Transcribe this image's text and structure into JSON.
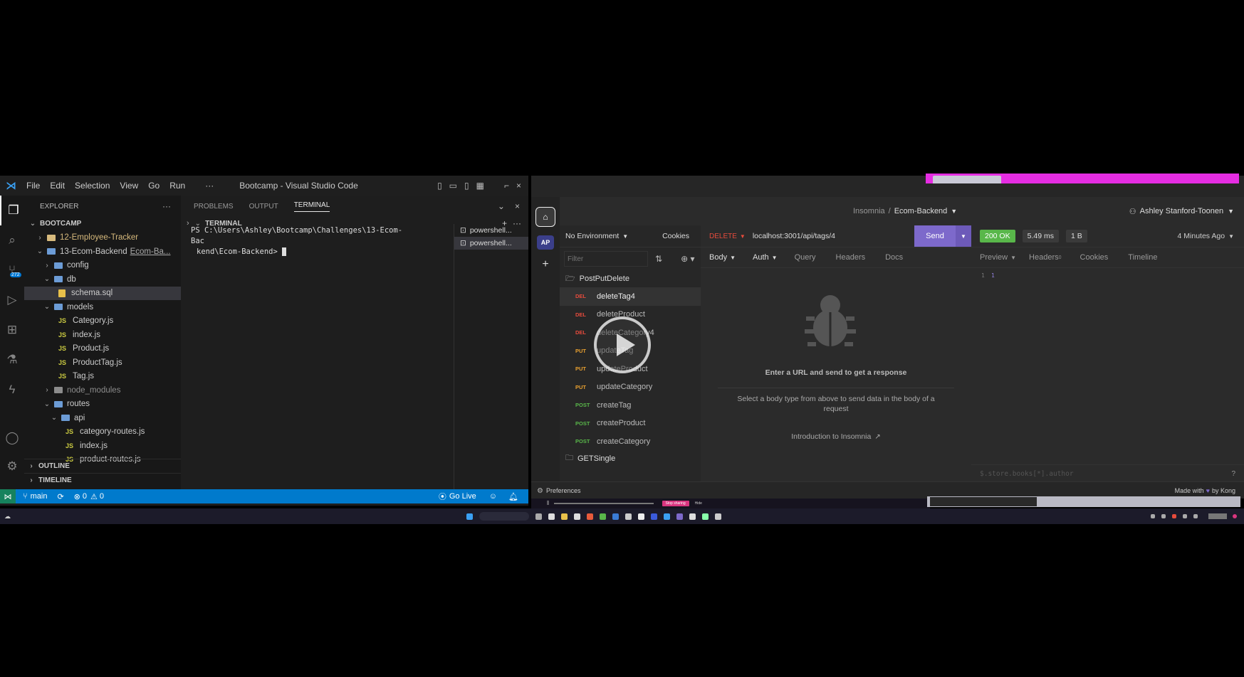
{
  "vscode": {
    "menu": [
      "File",
      "Edit",
      "Selection",
      "View",
      "Go",
      "Run"
    ],
    "menu_more": "···",
    "window_title": "Bootcamp - Visual Studio Code",
    "explorer_label": "EXPLORER",
    "explorer_more": "···",
    "workspace": "BOOTCAMP",
    "scm_badge": "272",
    "tree": [
      {
        "label": "12-Employee-Tracker",
        "depth": 1,
        "kind": "folder",
        "collapsed": true,
        "color": "#d7ba7d"
      },
      {
        "label": "13-Ecom-Backend",
        "path": "Ecom-Ba...",
        "depth": 1,
        "kind": "folder",
        "collapsed": false
      },
      {
        "label": "config",
        "depth": 2,
        "kind": "folder",
        "collapsed": true
      },
      {
        "label": "db",
        "depth": 2,
        "kind": "folder",
        "collapsed": false
      },
      {
        "label": "schema.sql",
        "depth": 3,
        "kind": "sql",
        "selected": true
      },
      {
        "label": "models",
        "depth": 2,
        "kind": "folder",
        "collapsed": false
      },
      {
        "label": "Category.js",
        "depth": 3,
        "kind": "js"
      },
      {
        "label": "index.js",
        "depth": 3,
        "kind": "js"
      },
      {
        "label": "Product.js",
        "depth": 3,
        "kind": "js"
      },
      {
        "label": "ProductTag.js",
        "depth": 3,
        "kind": "js"
      },
      {
        "label": "Tag.js",
        "depth": 3,
        "kind": "js"
      },
      {
        "label": "node_modules",
        "depth": 2,
        "kind": "folder",
        "collapsed": true,
        "color": "#8c8c8c"
      },
      {
        "label": "routes",
        "depth": 2,
        "kind": "folder",
        "collapsed": false
      },
      {
        "label": "api",
        "depth": 3,
        "kind": "folder",
        "collapsed": false
      },
      {
        "label": "category-routes.js",
        "depth": 4,
        "kind": "js"
      },
      {
        "label": "index.js",
        "depth": 4,
        "kind": "js"
      },
      {
        "label": "product-routes.js",
        "depth": 4,
        "kind": "js"
      }
    ],
    "outline_label": "OUTLINE",
    "timeline_label": "TIMELINE",
    "panel_tabs": [
      "PROBLEMS",
      "OUTPUT",
      "TERMINAL"
    ],
    "terminal_header": "TERMINAL",
    "terminal_line1": "PS C:\\Users\\Ashley\\Bootcamp\\Challenges\\13-Ecom-Bac",
    "terminal_line2": "kend\\Ecom-Backend> ",
    "terminal_sessions": [
      "powershell...",
      "powershell..."
    ],
    "status": {
      "branch": "main",
      "errors": "0",
      "warnings": "0",
      "golive": "Go Live"
    }
  },
  "insomnia": {
    "breadcrumb_root": "Insomnia",
    "breadcrumb_sep": "/",
    "project": "Ecom-Backend",
    "user": "Ashley Stanford-Toonen",
    "avatar_initials": "AP",
    "environment": "No Environment",
    "cookies": "Cookies",
    "filter_placeholder": "Filter",
    "folder_open": "PostPutDelete",
    "requests": [
      {
        "method": "DEL",
        "name": "deleteTag4",
        "active": true
      },
      {
        "method": "DEL",
        "name": "deleteProduct"
      },
      {
        "method": "DEL",
        "name": "deleteCategory4"
      },
      {
        "method": "PUT",
        "name": "updateTag"
      },
      {
        "method": "PUT",
        "name": "updateProduct"
      },
      {
        "method": "PUT",
        "name": "updateCategory"
      },
      {
        "method": "POST",
        "name": "createTag"
      },
      {
        "method": "POST",
        "name": "createProduct"
      },
      {
        "method": "POST",
        "name": "createCategory"
      }
    ],
    "folder_closed": "GETSingle",
    "preferences": "Preferences",
    "method": "DELETE",
    "url": "localhost:3001/api/tags/4",
    "send": "Send",
    "req_tabs": [
      "Body",
      "Auth",
      "Query",
      "Headers",
      "Docs"
    ],
    "empty_title": "Enter a URL and send to get a response",
    "empty_body": "Select a body type from above to send data in the body of a request",
    "intro_link": "Introduction to Insomnia",
    "status_code": "200 OK",
    "time": "5.49 ms",
    "size": "1 B",
    "ago": "4 Minutes Ago",
    "resp_tabs": [
      "Preview",
      "Headers",
      "Cookies",
      "Timeline"
    ],
    "headers_count": "0",
    "line_no": "1",
    "line_text": "1",
    "filter_expr": "$.store.books[*].author",
    "made_with": "Made with",
    "kong": "by Kong",
    "colors": {
      "accent": "#7d69cb",
      "ok": "#59b74a",
      "del": "#e64b3c",
      "put": "#e8a030",
      "post": "#59b74a"
    }
  },
  "recorder": {
    "stop_label": "Stop sharing",
    "hide_label": "Hide"
  }
}
